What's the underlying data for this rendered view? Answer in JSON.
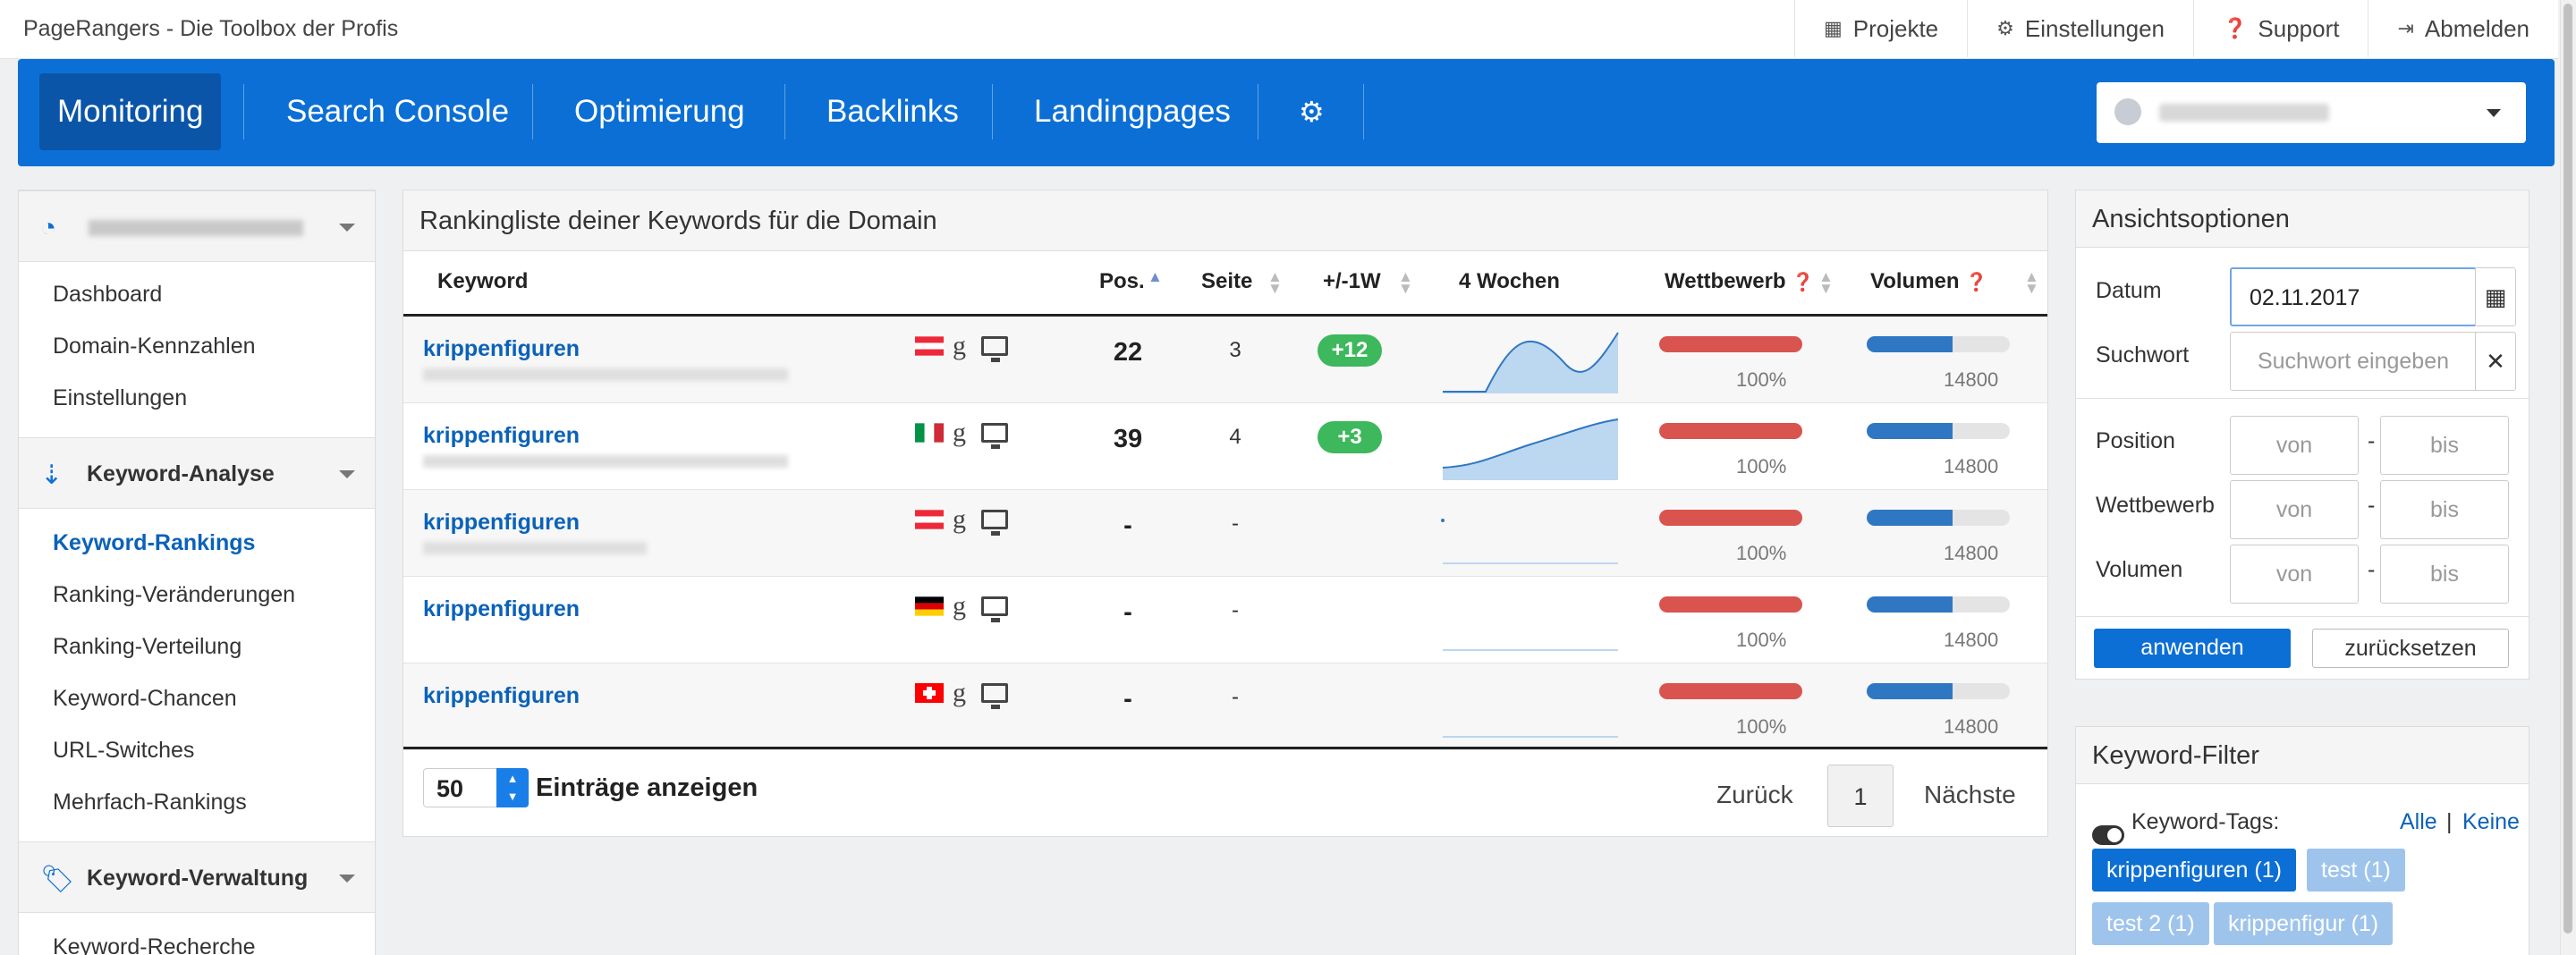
{
  "brand": "PageRangers - Die Toolbox der Profis",
  "toplinks": [
    {
      "icon": "table-icon",
      "label": "Projekte"
    },
    {
      "icon": "gear-icon",
      "label": "Einstellungen"
    },
    {
      "icon": "help-icon",
      "label": "Support"
    },
    {
      "icon": "logout-icon",
      "label": "Abmelden"
    }
  ],
  "nav": {
    "items": [
      "Monitoring",
      "Search Console",
      "Optimierung",
      "Backlinks",
      "Landingpages"
    ],
    "active": "Monitoring",
    "settings_icon": "gear-icon",
    "domain_select_icon": "globe-icon"
  },
  "sidebar": {
    "section1_icon": "dashboard-icon",
    "items1": [
      "Dashboard",
      "Domain-Kennzahlen",
      "Einstellungen"
    ],
    "section2": {
      "icon": "sort-icon",
      "title": "Keyword-Analyse"
    },
    "items2": [
      "Keyword-Rankings",
      "Ranking-Veränderungen",
      "Ranking-Verteilung",
      "Keyword-Chancen",
      "URL-Switches",
      "Mehrfach-Rankings"
    ],
    "active": "Keyword-Rankings",
    "section3": {
      "icon": "tags-icon",
      "title": "Keyword-Verwaltung"
    },
    "items3": [
      "Keyword-Recherche"
    ]
  },
  "main": {
    "title": "Rankingliste deiner Keywords für die Domain",
    "columns": {
      "keyword": "Keyword",
      "pos": "Pos.",
      "seite": "Seite",
      "change": "+/-1W",
      "weeks": "4 Wochen",
      "wettbewerb": "Wettbewerb",
      "volumen": "Volumen"
    },
    "rows": [
      {
        "keyword": "krippenfiguren",
        "country": "AT",
        "pos": "22",
        "seite": "3",
        "change": "+12",
        "wettbewerb_pct": "100%",
        "wettbewerb_level": 1.0,
        "volumen": "14800",
        "volumen_level": 0.6,
        "trend": "wave"
      },
      {
        "keyword": "krippenfiguren",
        "country": "IT",
        "pos": "39",
        "seite": "4",
        "change": "+3",
        "wettbewerb_pct": "100%",
        "wettbewerb_level": 1.0,
        "volumen": "14800",
        "volumen_level": 0.6,
        "trend": "rise"
      },
      {
        "keyword": "krippenfiguren",
        "country": "AT",
        "pos": "-",
        "seite": "-",
        "change": "",
        "wettbewerb_pct": "100%",
        "wettbewerb_level": 1.0,
        "volumen": "14800",
        "volumen_level": 0.6,
        "trend": "flat"
      },
      {
        "keyword": "krippenfiguren",
        "country": "DE",
        "pos": "-",
        "seite": "-",
        "change": "",
        "wettbewerb_pct": "100%",
        "wettbewerb_level": 1.0,
        "volumen": "14800",
        "volumen_level": 0.6,
        "trend": "flat"
      },
      {
        "keyword": "krippenfiguren",
        "country": "CH",
        "pos": "-",
        "seite": "-",
        "change": "",
        "wettbewerb_pct": "100%",
        "wettbewerb_level": 1.0,
        "volumen": "14800",
        "volumen_level": 0.6,
        "trend": "flat"
      }
    ],
    "per_page": "50",
    "per_page_label": "Einträge anzeigen",
    "prev": "Zurück",
    "page": "1",
    "next": "Nächste"
  },
  "options": {
    "title": "Ansichtsoptionen",
    "datum_label": "Datum",
    "datum_value": "02.11.2017",
    "suchwort_label": "Suchwort",
    "suchwort_placeholder": "Suchwort eingeben",
    "position_label": "Position",
    "wettbewerb_label": "Wettbewerb",
    "volumen_label": "Volumen",
    "von": "von",
    "bis": "bis",
    "dash": "-",
    "apply": "anwenden",
    "reset": "zurücksetzen"
  },
  "filter": {
    "title": "Keyword-Filter",
    "tags_label": "Keyword-Tags:",
    "all": "Alle",
    "separator": "|",
    "none": "Keine",
    "tags": [
      {
        "label": "krippenfiguren (1)",
        "active": true
      },
      {
        "label": "test (1)",
        "active": false
      },
      {
        "label": "test 2 (1)",
        "active": false
      },
      {
        "label": "krippenfigur (1)",
        "active": false
      }
    ]
  },
  "colors": {
    "primary": "#0c6fd5",
    "danger": "#d9534f",
    "success": "#3db85c",
    "bar_blue": "#2f77c2"
  }
}
